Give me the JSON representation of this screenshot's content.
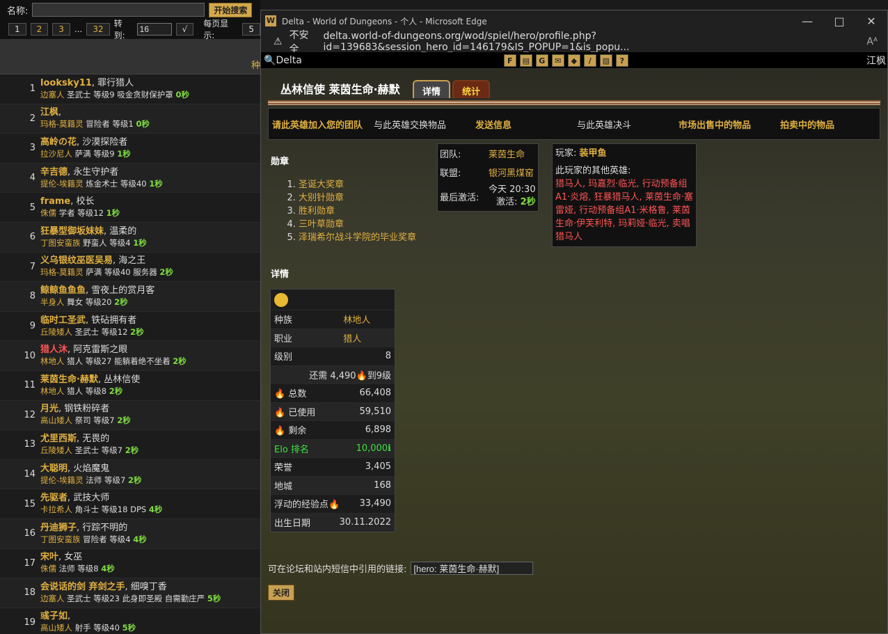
{
  "left": {
    "name_label": "名称:",
    "search_btn": "开始搜索",
    "pages": [
      "1",
      "2",
      "3",
      "...",
      "32"
    ],
    "goto_label": "转到:",
    "goto_value": "16",
    "goto_btn": "√",
    "perpage_label": "每页显示:",
    "perpage_value": "5",
    "header_col": "种",
    "rows": [
      {
        "n": "1",
        "name": "looksky11",
        "red": false,
        "title": ", 罪行猎人",
        "race": "边塞人",
        "sub": " 圣武士 等级9 吸金贪财保护罩 ",
        "t": "0秒"
      },
      {
        "n": "2",
        "name": "江枫",
        "red": false,
        "title": ",",
        "race": "玛格-莫籍灵",
        "sub": " 冒险者 等级1 ",
        "t": "0秒"
      },
      {
        "n": "3",
        "name": "高岭の花",
        "red": false,
        "title": ", 沙漠探险者",
        "race": "拉沙尼人",
        "sub": " 萨满 等级9 ",
        "t": "1秒"
      },
      {
        "n": "4",
        "name": "辛吉德",
        "red": false,
        "title": ", 永生守护者",
        "race": "提伦-埃籍灵",
        "sub": " 炼金术士 等级40 ",
        "t": "1秒"
      },
      {
        "n": "5",
        "name": "frame",
        "red": false,
        "title": ", 校长",
        "race": "侏儒",
        "sub": " 学者 等级12 ",
        "t": "1秒"
      },
      {
        "n": "6",
        "name": "狂暴型御坂妹妹",
        "red": false,
        "title": ", 温柔的",
        "race": "丁图安蛮族",
        "sub": " 野蛮人 等级4 ",
        "t": "1秒"
      },
      {
        "n": "7",
        "name": "义乌银纹巫医吴易",
        "red": false,
        "title": ", 海之王",
        "race": "玛格-莫籍灵",
        "sub": " 萨满 等级40 服务器 ",
        "t": "2秒"
      },
      {
        "n": "8",
        "name": "鲸鲸鱼鱼鱼",
        "red": false,
        "title": ", 雪夜上的赏月客",
        "race": "半身人",
        "sub": " 舞女 等级20 ",
        "t": "2秒"
      },
      {
        "n": "9",
        "name": "临时工圣武",
        "red": false,
        "title": ", 铁砧拥有者",
        "race": "丘陵矮人",
        "sub": " 圣武士 等级12 ",
        "t": "2秒"
      },
      {
        "n": "10",
        "name": "猎人沐",
        "red": true,
        "title": ", 阿克雷斯之眼",
        "race": "林地人",
        "sub": " 猎人 等级27 能躺着绝不坐着 ",
        "t": "2秒"
      },
      {
        "n": "11",
        "name": "莱茵生命·赫默",
        "red": false,
        "title": ", 丛林信使",
        "race": "林地人",
        "sub": " 猎人 等级8 ",
        "t": "2秒"
      },
      {
        "n": "12",
        "name": "月光",
        "red": false,
        "title": ", 钢铁粉碎者",
        "race": "高山矮人",
        "sub": " 祭司 等级7 ",
        "t": "2秒"
      },
      {
        "n": "13",
        "name": "尤里西斯",
        "red": false,
        "title": ", 无畏的",
        "race": "丘陵矮人",
        "sub": " 圣武士 等级7 ",
        "t": "2秒"
      },
      {
        "n": "14",
        "name": "大聪明",
        "red": false,
        "title": ", 火焰魔鬼",
        "race": "提伦-埃籍灵",
        "sub": " 法师 等级7 ",
        "t": "2秒"
      },
      {
        "n": "15",
        "name": "先驱者",
        "red": false,
        "title": ", 武技大师",
        "race": "卡拉希人",
        "sub": " 角斗士 等级18 DPS ",
        "t": "4秒"
      },
      {
        "n": "16",
        "name": "丹迪狮子",
        "red": false,
        "title": ", 行踪不明的",
        "race": "丁图安蛮族",
        "sub": " 冒险者 等级4 ",
        "t": "4秒"
      },
      {
        "n": "17",
        "name": "宋叶",
        "red": false,
        "title": ", 女巫",
        "race": "侏儒",
        "sub": " 法师 等级8 ",
        "t": "4秒"
      },
      {
        "n": "18",
        "name": "会说话的剑 弃剑之手",
        "red": false,
        "title": ", 细嗅丁香",
        "race": "边塞人",
        "sub": " 圣武士 等级23 此身即圣殿 自需勤庄严 ",
        "t": "5秒"
      },
      {
        "n": "19",
        "name": "彧子如",
        "red": false,
        "title": ",",
        "race": "高山矮人",
        "sub": " 射手 等级40 ",
        "t": "5秒"
      }
    ]
  },
  "window": {
    "title": "Delta - World of Dungeons - 个人 - Microsoft Edge",
    "icon": "W",
    "insecure": "不安全",
    "url": "delta.world-of-dungeons.org/wod/spiel/hero/profile.php?id=139683&session_hero_id=146179&IS_POPUP=1&is_popu...",
    "reader": "Aᴬ"
  },
  "game": {
    "world": "Delta",
    "right": "江枫",
    "icons": [
      "F",
      "▤",
      "G",
      "✉",
      "◆",
      "/",
      "▧",
      "?"
    ]
  },
  "hero": {
    "heading": "丛林信使 莱茵生命·赫默",
    "tab1": "详情",
    "tab2": "统计",
    "actions": {
      "invite": "请此英雄加入您的团队",
      "trade": "与此英雄交换物品",
      "message": "发送信息",
      "duel": "与此英雄决斗",
      "market": "市场出售中的物品",
      "auction": "拍卖中的物品"
    },
    "medals_title": "勋章",
    "medals": [
      "圣诞大奖章",
      "大别针勋章",
      "胜利勋章",
      "三叶草勋章",
      "泽瑞希尔战斗学院的毕业奖章"
    ],
    "guild": {
      "team_label": "团队:",
      "team": "莱茵生命",
      "alliance_label": "联盟:",
      "alliance": "银河黑煤窑",
      "last_label": "最后激活:",
      "last": "今天 20:30",
      "active_label": "激活:",
      "active": "2秒"
    },
    "player": {
      "label": "玩家:",
      "name": "装甲鱼",
      "others_label": "此玩家的其他英雄:",
      "others": "猎马人, 玛嘉烈·临光, 行动预备组A1·炎熔, 狂暴猎马人, 莱茵生命·塞雷娅, 行动预备组A1·米格鲁, 莱茵生命·伊芙利特, 玛莉娅·临光, 卖唱猎马人"
    },
    "details_title": "详情",
    "details": [
      {
        "k": "种族",
        "v": "林地人",
        "style": "y"
      },
      {
        "k": "职业",
        "v": "猎人",
        "style": "y"
      },
      {
        "k": "级别",
        "v": "8",
        "style": ""
      },
      {
        "k": "",
        "v": "还需 4,490🔥到9级",
        "style": ""
      },
      {
        "k": "🔥 总数",
        "v": "66,408",
        "style": ""
      },
      {
        "k": "🔥 已使用",
        "v": "59,510",
        "style": ""
      },
      {
        "k": "🔥 剩余",
        "v": "6,898",
        "style": ""
      },
      {
        "k": "Elo 排名",
        "v": "10,000ℹ",
        "style": "g"
      },
      {
        "k": "荣誉",
        "v": "3,405",
        "style": ""
      },
      {
        "k": "地城",
        "v": "168",
        "style": ""
      },
      {
        "k": "浮动的经验点🔥",
        "v": "33,490",
        "style": ""
      },
      {
        "k": "出生日期",
        "v": "30.11.2022",
        "style": ""
      }
    ],
    "link_label": "可在论坛和站内短信中引用的链接:",
    "link_value": "[hero: 莱茵生命·赫默]",
    "close": "关闭"
  }
}
